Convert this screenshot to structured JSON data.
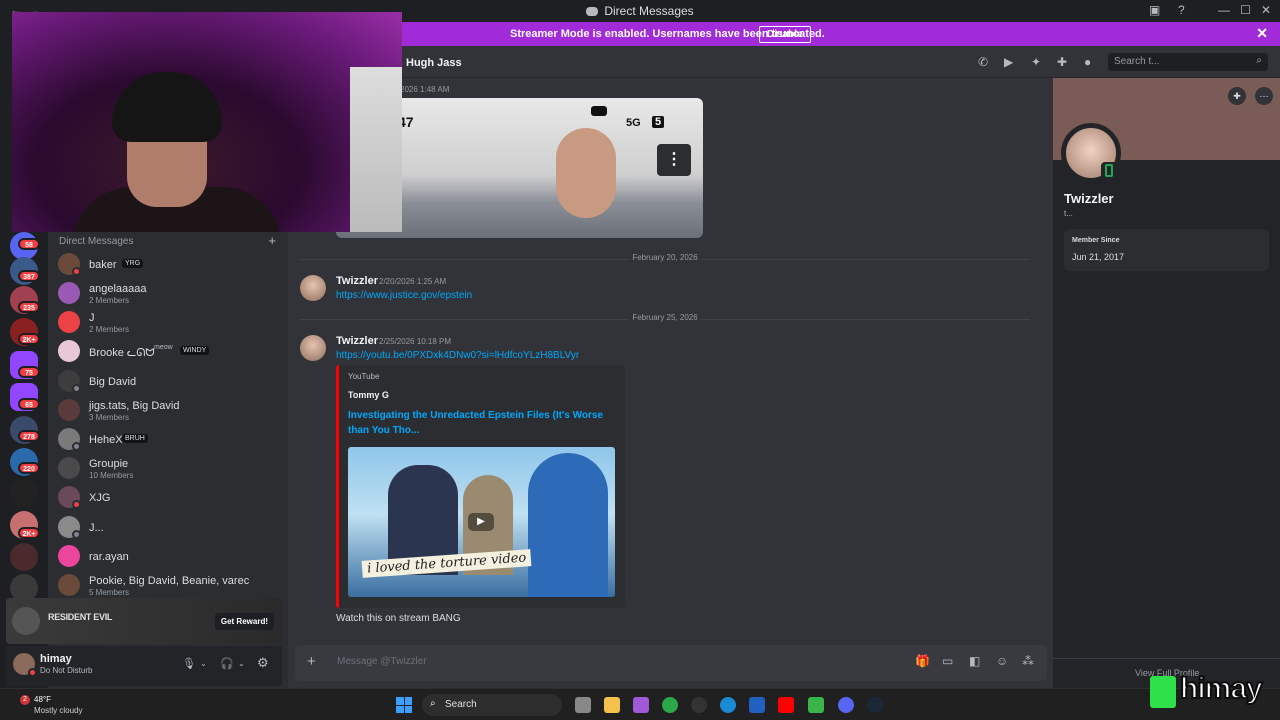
{
  "window": {
    "title": "Direct Messages"
  },
  "streamer_banner": {
    "text": "Streamer Mode is enabled. Usernames have been truncated.",
    "disable_label": "Disable",
    "close_icon": "close-icon"
  },
  "guild_badges": [
    "58",
    "387",
    "235",
    "2K+",
    "75",
    "65",
    "278",
    "220",
    "2K+"
  ],
  "dm_sidebar": {
    "header": "Direct Messages",
    "items": [
      {
        "name": "baker",
        "tag": "YRG",
        "sub": "",
        "color": "#6b4a3a",
        "status": "#f23f43"
      },
      {
        "name": "angelaaaaa",
        "tag": "",
        "sub": "2 Members",
        "color": "#9b59b6",
        "status": ""
      },
      {
        "name": "J",
        "tag": "",
        "sub": "2 Members",
        "color": "#ed4245",
        "status": ""
      },
      {
        "name": "Brooke ᓚᘏᗢ",
        "tag": "WINDY",
        "extra": "meow",
        "sub": "",
        "color": "#e9c8d5",
        "status": ""
      },
      {
        "name": "Big David",
        "tag": "",
        "sub": "",
        "color": "#3d3d3d",
        "status": "#80848e"
      },
      {
        "name": "jigs.tats, Big David",
        "tag": "",
        "sub": "3 Members",
        "color": "#5a3a3a",
        "status": ""
      },
      {
        "name": "HeheXD",
        "tag": "BRUH",
        "sub": "",
        "color": "#7a7a7a",
        "status": "#80848e"
      },
      {
        "name": "Groupie",
        "tag": "",
        "sub": "10 Members",
        "color": "#4a4a4a",
        "status": ""
      },
      {
        "name": "XJG",
        "tag": "",
        "sub": "",
        "color": "#6a4a5a",
        "status": "#f23f43"
      },
      {
        "name": "J...",
        "tag": "",
        "sub": "",
        "color": "#8a8a8a",
        "status": "#80848e"
      },
      {
        "name": "rar.ayan",
        "tag": "",
        "sub": "",
        "color": "#eb459e",
        "status": ""
      },
      {
        "name": "Pookie, Big David, Beanie, varec",
        "tag": "",
        "sub": "5 Members",
        "color": "#6a4a3a",
        "status": ""
      }
    ]
  },
  "promo": {
    "game": "RESIDENT EVIL",
    "cta": "Get Reward!"
  },
  "user": {
    "name": "himay",
    "status": "Do Not Disturb"
  },
  "chat_header": {
    "name": "Hugh Jass",
    "search_placeholder": "Search t..."
  },
  "messages": {
    "top_time": "2026 1:48 AM",
    "image_overlay": {
      "left_text": "47",
      "right_text": "5G",
      "badge": "5"
    },
    "divider_1": "February 20, 2026",
    "msg_1": {
      "author": "Twizzler",
      "time": "2/20/2026 1:25 AM",
      "link": "https://www.justice.gov/epstein"
    },
    "divider_2": "February 25, 2026",
    "msg_2": {
      "author": "Twizzler",
      "time": "2/25/2026 10:18 PM",
      "link": "https://youtu.be/0PXDxk4DNw0?si=lHdfcoYLzH8BLVyr",
      "embed": {
        "provider": "YouTube",
        "author": "Tommy G",
        "title": "Investigating the Unredacted Epstein Files (It's Worse than You Tho...",
        "thumb_caption": "i loved the torture video"
      },
      "text": "Watch this on stream BANG"
    }
  },
  "composer": {
    "placeholder": "Message @Twizzler"
  },
  "profile": {
    "name": "Twizzler",
    "subtitle": "t...",
    "member_since_label": "Member Since",
    "member_since": "Jun 21, 2017",
    "view_full": "View Full Profile"
  },
  "taskbar": {
    "temp": "48°F",
    "weather": "Mostly cloudy",
    "weather_badge": "2",
    "search_placeholder": "Search"
  },
  "watermark": "himay"
}
